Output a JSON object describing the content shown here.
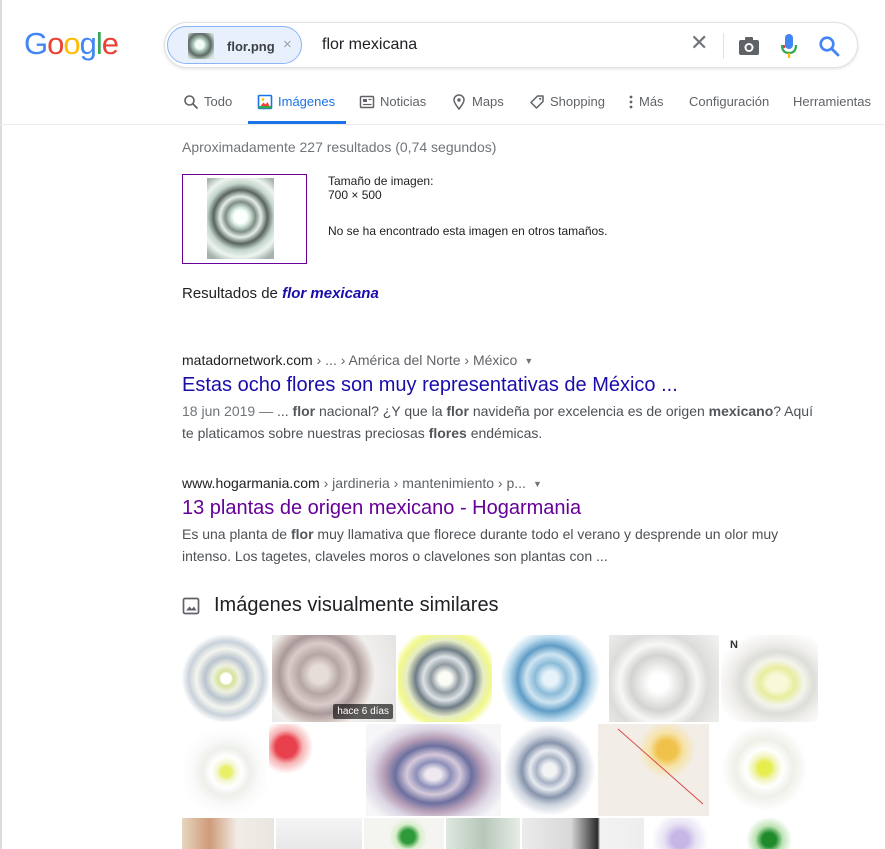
{
  "logo": {
    "text": "Google",
    "letters": [
      "G",
      "o",
      "o",
      "g",
      "l",
      "e"
    ],
    "colors": [
      "#4285f4",
      "#ea4335",
      "#fbbc05",
      "#4285f4",
      "#34a853",
      "#ea4335"
    ]
  },
  "search": {
    "chip_file": "flor.png",
    "chip_remove": "×",
    "query": "flor mexicana",
    "clear": "✕"
  },
  "tabs": [
    {
      "label": "Todo",
      "icon": "search-icon",
      "active": false
    },
    {
      "label": "Imágenes",
      "icon": "image-icon",
      "active": true
    },
    {
      "label": "Noticias",
      "icon": "news-icon",
      "active": false
    },
    {
      "label": "Maps",
      "icon": "map-pin-icon",
      "active": false
    },
    {
      "label": "Shopping",
      "icon": "tag-icon",
      "active": false
    },
    {
      "label": "Más",
      "icon": "more-vert-icon",
      "active": false
    },
    {
      "label": "Configuración",
      "icon": "",
      "active": false
    },
    {
      "label": "Herramientas",
      "icon": "",
      "active": false
    }
  ],
  "stats": "Aproximadamente 227 resultados (0,74 segundos)",
  "image_info": {
    "size_label": "Tamaño de imagen:",
    "size_value": "700 × 500",
    "not_found": "No se ha encontrado esta imagen en otros tamaños."
  },
  "results_for": {
    "prefix": "Resultados de ",
    "query": "flor mexicana"
  },
  "results": [
    {
      "domain": "matadornetwork.com",
      "path": " › ... › América del Norte › México",
      "title": "Estas ocho flores son muy representativas de México ...",
      "visited": false,
      "date": "18 jun 2019 — ",
      "snippet_parts": [
        {
          "t": "... ",
          "b": false
        },
        {
          "t": "flor",
          "b": true
        },
        {
          "t": " nacional? ¿Y que la ",
          "b": false
        },
        {
          "t": "flor",
          "b": true
        },
        {
          "t": " navideña por excelencia es de origen ",
          "b": false
        },
        {
          "t": "mexicano",
          "b": true
        },
        {
          "t": "? Aquí te platicamos sobre nuestras preciosas ",
          "b": false
        },
        {
          "t": "flores",
          "b": true
        },
        {
          "t": " endémicas.",
          "b": false
        }
      ]
    },
    {
      "domain": "www.hogarmania.com",
      "path": " › jardineria › mantenimiento › p...",
      "title": "13 plantas de origen mexicano - Hogarmania",
      "visited": true,
      "date": "",
      "snippet_parts": [
        {
          "t": "Es una planta de ",
          "b": false
        },
        {
          "t": "flor",
          "b": true
        },
        {
          "t": " muy llamativa que florece durante todo el verano y desprende un olor muy intenso. Los tagetes, claveles moros o clavelones son plantas con ...",
          "b": false
        }
      ]
    }
  ],
  "similar": {
    "heading": "Imágenes visualmente similares",
    "badge": "hace 6 días",
    "tile_marker": "N"
  }
}
